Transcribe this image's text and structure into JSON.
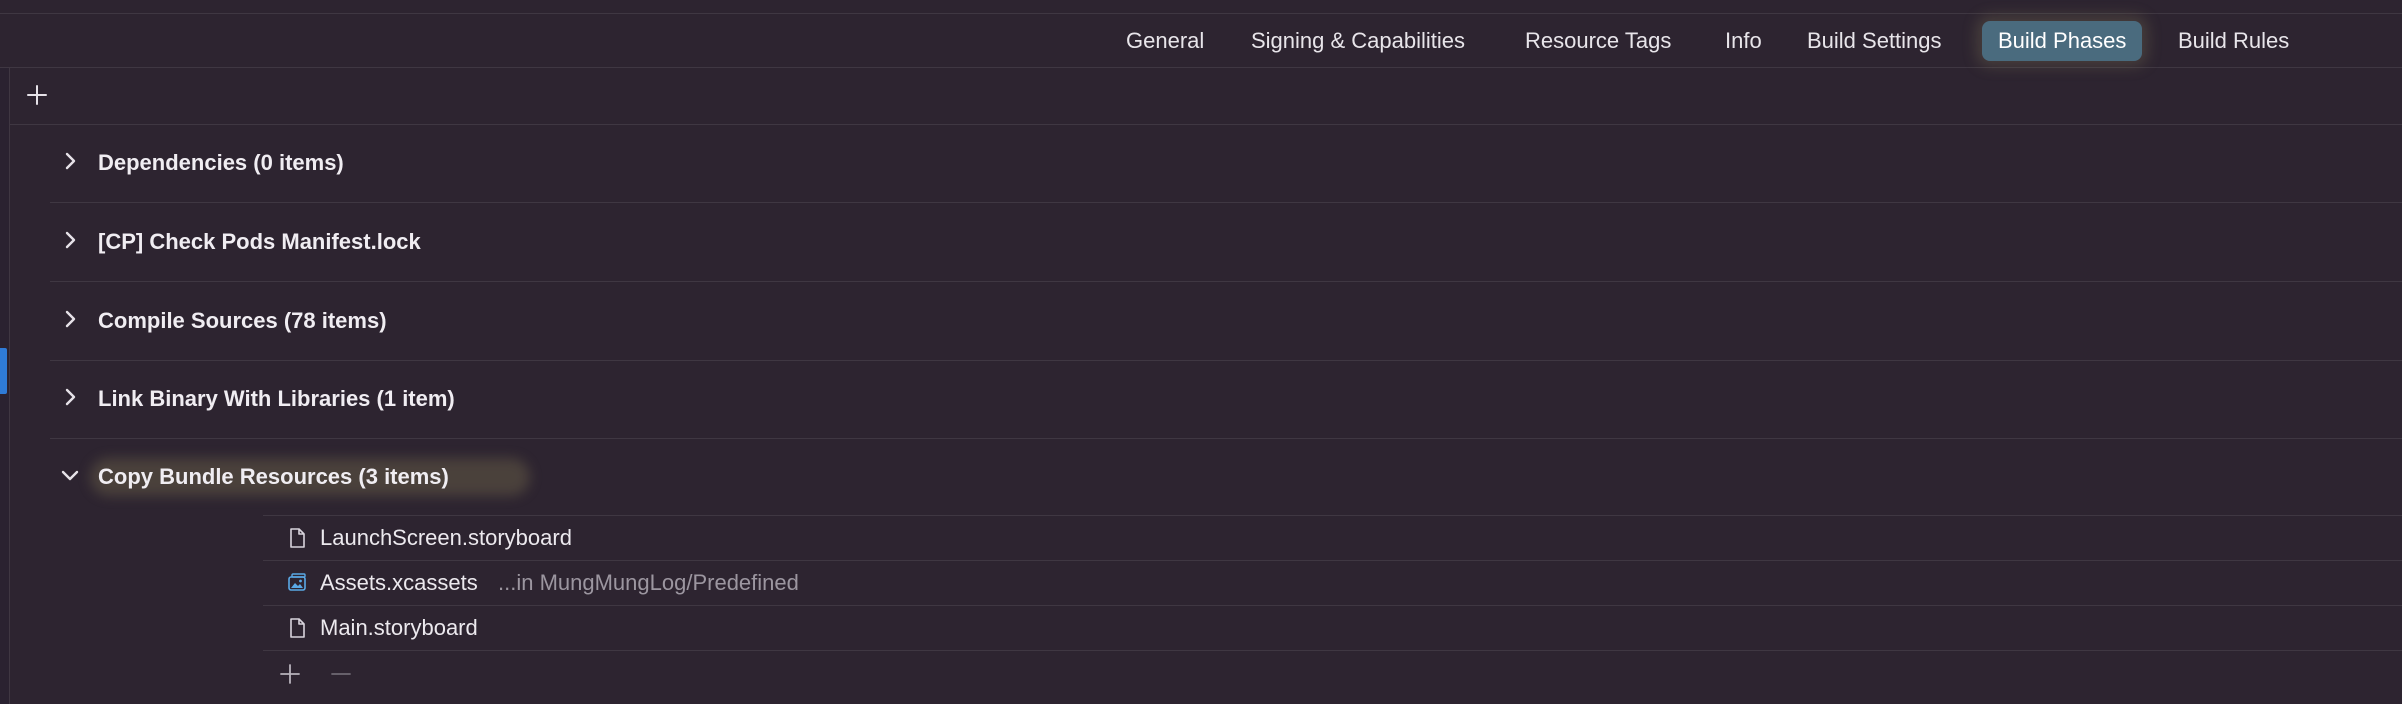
{
  "tabs": [
    {
      "label": "General",
      "selected": false
    },
    {
      "label": "Signing & Capabilities",
      "selected": false
    },
    {
      "label": "Resource Tags",
      "selected": false
    },
    {
      "label": "Info",
      "selected": false
    },
    {
      "label": "Build Settings",
      "selected": false
    },
    {
      "label": "Build Phases",
      "selected": true
    },
    {
      "label": "Build Rules",
      "selected": false
    }
  ],
  "phases": [
    {
      "title": "Dependencies (0 items)",
      "expanded": false
    },
    {
      "title": "[CP] Check Pods Manifest.lock",
      "expanded": false
    },
    {
      "title": "Compile Sources (78 items)",
      "expanded": false
    },
    {
      "title": "Link Binary With Libraries (1 item)",
      "expanded": false
    },
    {
      "title": "Copy Bundle Resources (3 items)",
      "expanded": true
    }
  ],
  "bundle_resources": [
    {
      "name": "LaunchScreen.storyboard",
      "location": "",
      "icon": "document-icon"
    },
    {
      "name": "Assets.xcassets",
      "location": "...in MungMungLog/Predefined",
      "icon": "asset-catalog-icon"
    },
    {
      "name": "Main.storyboard",
      "location": "",
      "icon": "document-icon"
    }
  ],
  "colors": {
    "background": "#2d2430",
    "selected_tab": "#4a6b7e",
    "separator": "#3f3742",
    "accent": "#2f7bd6"
  }
}
